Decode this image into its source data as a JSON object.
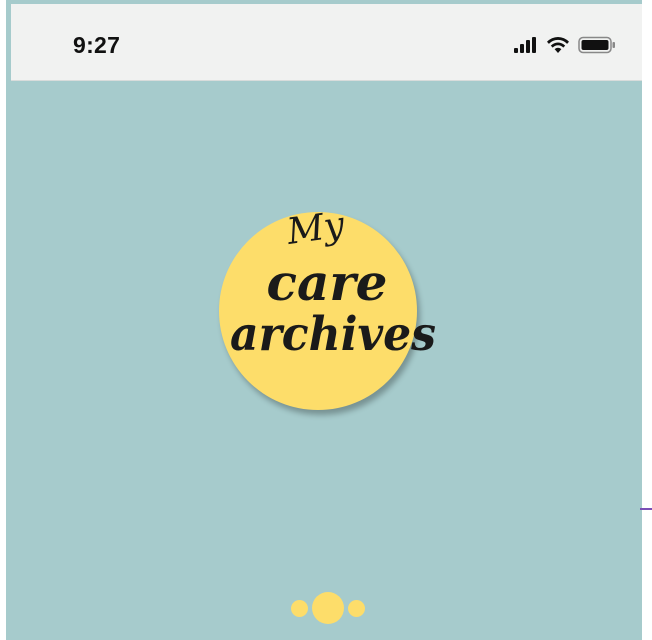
{
  "status_bar": {
    "time": "9:27",
    "icons": [
      "cellular-signal-icon",
      "wifi-icon",
      "battery-icon"
    ]
  },
  "logo": {
    "line1": "My",
    "line2": "care",
    "line3": "archives",
    "circle_color": "#fddd6a",
    "text_color": "#1a1a1a"
  },
  "pager": {
    "page_count": 3,
    "active_page": 2
  },
  "colors": {
    "background": "#a6cbcc",
    "status_bar": "#f1f2f1",
    "accent": "#fddd6a"
  }
}
